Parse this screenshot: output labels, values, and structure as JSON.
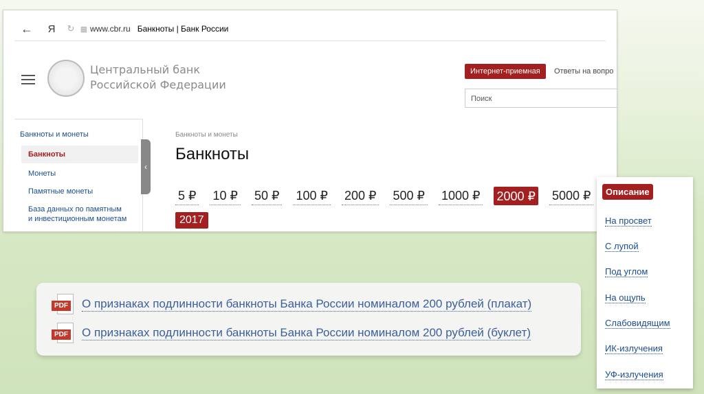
{
  "browser": {
    "back_icon": "arrow-left-icon",
    "ya_label": "Я",
    "url": "www.cbr.ru",
    "tab_title": "Банкноты | Банк России"
  },
  "header": {
    "bank_name_line1": "Центральный банк",
    "bank_name_line2": "Российской Федерации",
    "internet_reception": "Интернет-приемная",
    "answers": "Ответы на вопро",
    "search_placeholder": "Поиск"
  },
  "sidebar": {
    "head": "Банкноты и монеты",
    "items": [
      {
        "label": "Банкноты",
        "active": true
      },
      {
        "label": "Монеты"
      },
      {
        "label": "Памятные монеты"
      },
      {
        "label": "База данных по памятным"
      },
      {
        "label": "и инвестиционным монетам"
      }
    ]
  },
  "main": {
    "breadcrumb": "Банкноты и монеты",
    "title": "Банкноты",
    "denominations": [
      "5 ₽",
      "10 ₽",
      "50 ₽",
      "100 ₽",
      "200 ₽",
      "500 ₽",
      "1000 ₽",
      "2000 ₽",
      "5000 ₽"
    ],
    "active_denomination": "2000 ₽",
    "year": "2017"
  },
  "pdf_links": [
    "О признаках подлинности банкноты Банка России номиналом 200 рублей (плакат)",
    "О признаках подлинности банкноты Банка России номиналом 200 рублей (буклет)"
  ],
  "pdf_label": "PDF",
  "side_menu": {
    "active": "Описание",
    "items": [
      "На просвет",
      "С лупой",
      "Под углом",
      "На ощупь",
      "Слабовидящим",
      "ИК-излучения",
      "УФ-излучения"
    ]
  },
  "colors": {
    "accent": "#a41f1f",
    "link": "#1b4d8c"
  }
}
